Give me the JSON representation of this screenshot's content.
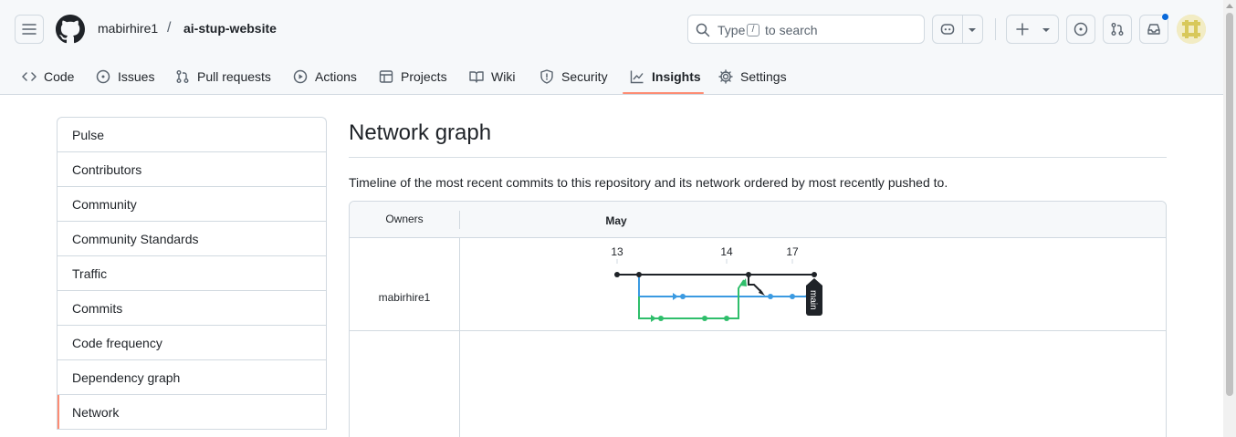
{
  "header": {
    "owner": "mabirhire1",
    "separator": "/",
    "repo": "ai-stup-website",
    "search": {
      "prefix": "Type",
      "key": "/",
      "suffix": "to search"
    },
    "icons": [
      "menu-icon",
      "github-logo-icon",
      "search-icon",
      "copilot-icon",
      "chevron-down-icon",
      "plus-icon",
      "issue-opened-icon",
      "pull-request-icon",
      "inbox-icon",
      "avatar"
    ]
  },
  "tabs": [
    {
      "label": "Code",
      "icon": "code-icon"
    },
    {
      "label": "Issues",
      "icon": "issue-opened-icon"
    },
    {
      "label": "Pull requests",
      "icon": "pull-request-icon"
    },
    {
      "label": "Actions",
      "icon": "play-icon"
    },
    {
      "label": "Projects",
      "icon": "table-icon"
    },
    {
      "label": "Wiki",
      "icon": "book-icon"
    },
    {
      "label": "Security",
      "icon": "shield-icon"
    },
    {
      "label": "Insights",
      "icon": "graph-icon",
      "active": true
    },
    {
      "label": "Settings",
      "icon": "gear-icon"
    }
  ],
  "sidebar": {
    "items": [
      {
        "label": "Pulse"
      },
      {
        "label": "Contributors"
      },
      {
        "label": "Community"
      },
      {
        "label": "Community Standards"
      },
      {
        "label": "Traffic"
      },
      {
        "label": "Commits"
      },
      {
        "label": "Code frequency"
      },
      {
        "label": "Dependency graph"
      },
      {
        "label": "Network",
        "selected": true
      }
    ]
  },
  "main": {
    "title": "Network graph",
    "description": "Timeline of the most recent commits to this repository and its network ordered by most recently pushed to."
  },
  "network": {
    "owners_header": "Owners",
    "month": "May",
    "days": [
      "13",
      "14",
      "17"
    ],
    "owner": "mabirhire1",
    "branch_label": "main",
    "colors": {
      "main": "#1f2328",
      "branch_blue": "#3b9ae1",
      "branch_green": "#2fbe6b",
      "accent": "#fd8c73",
      "link": "#0969da"
    }
  }
}
